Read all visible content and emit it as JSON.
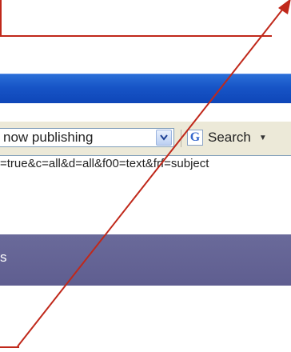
{
  "toolbar": {
    "search_value": "now publishing",
    "search_button_label": "Search",
    "url_text": "=true&c=all&d=all&f00=text&frf=subject"
  },
  "banner": {
    "text": "s"
  },
  "colors": {
    "annotation": "#c0281a",
    "titlebar": "#1754c6",
    "banner": "#66659a"
  },
  "icons": [
    "dropdown-arrow-icon",
    "google-logo-icon",
    "arrow-head-icon"
  ]
}
